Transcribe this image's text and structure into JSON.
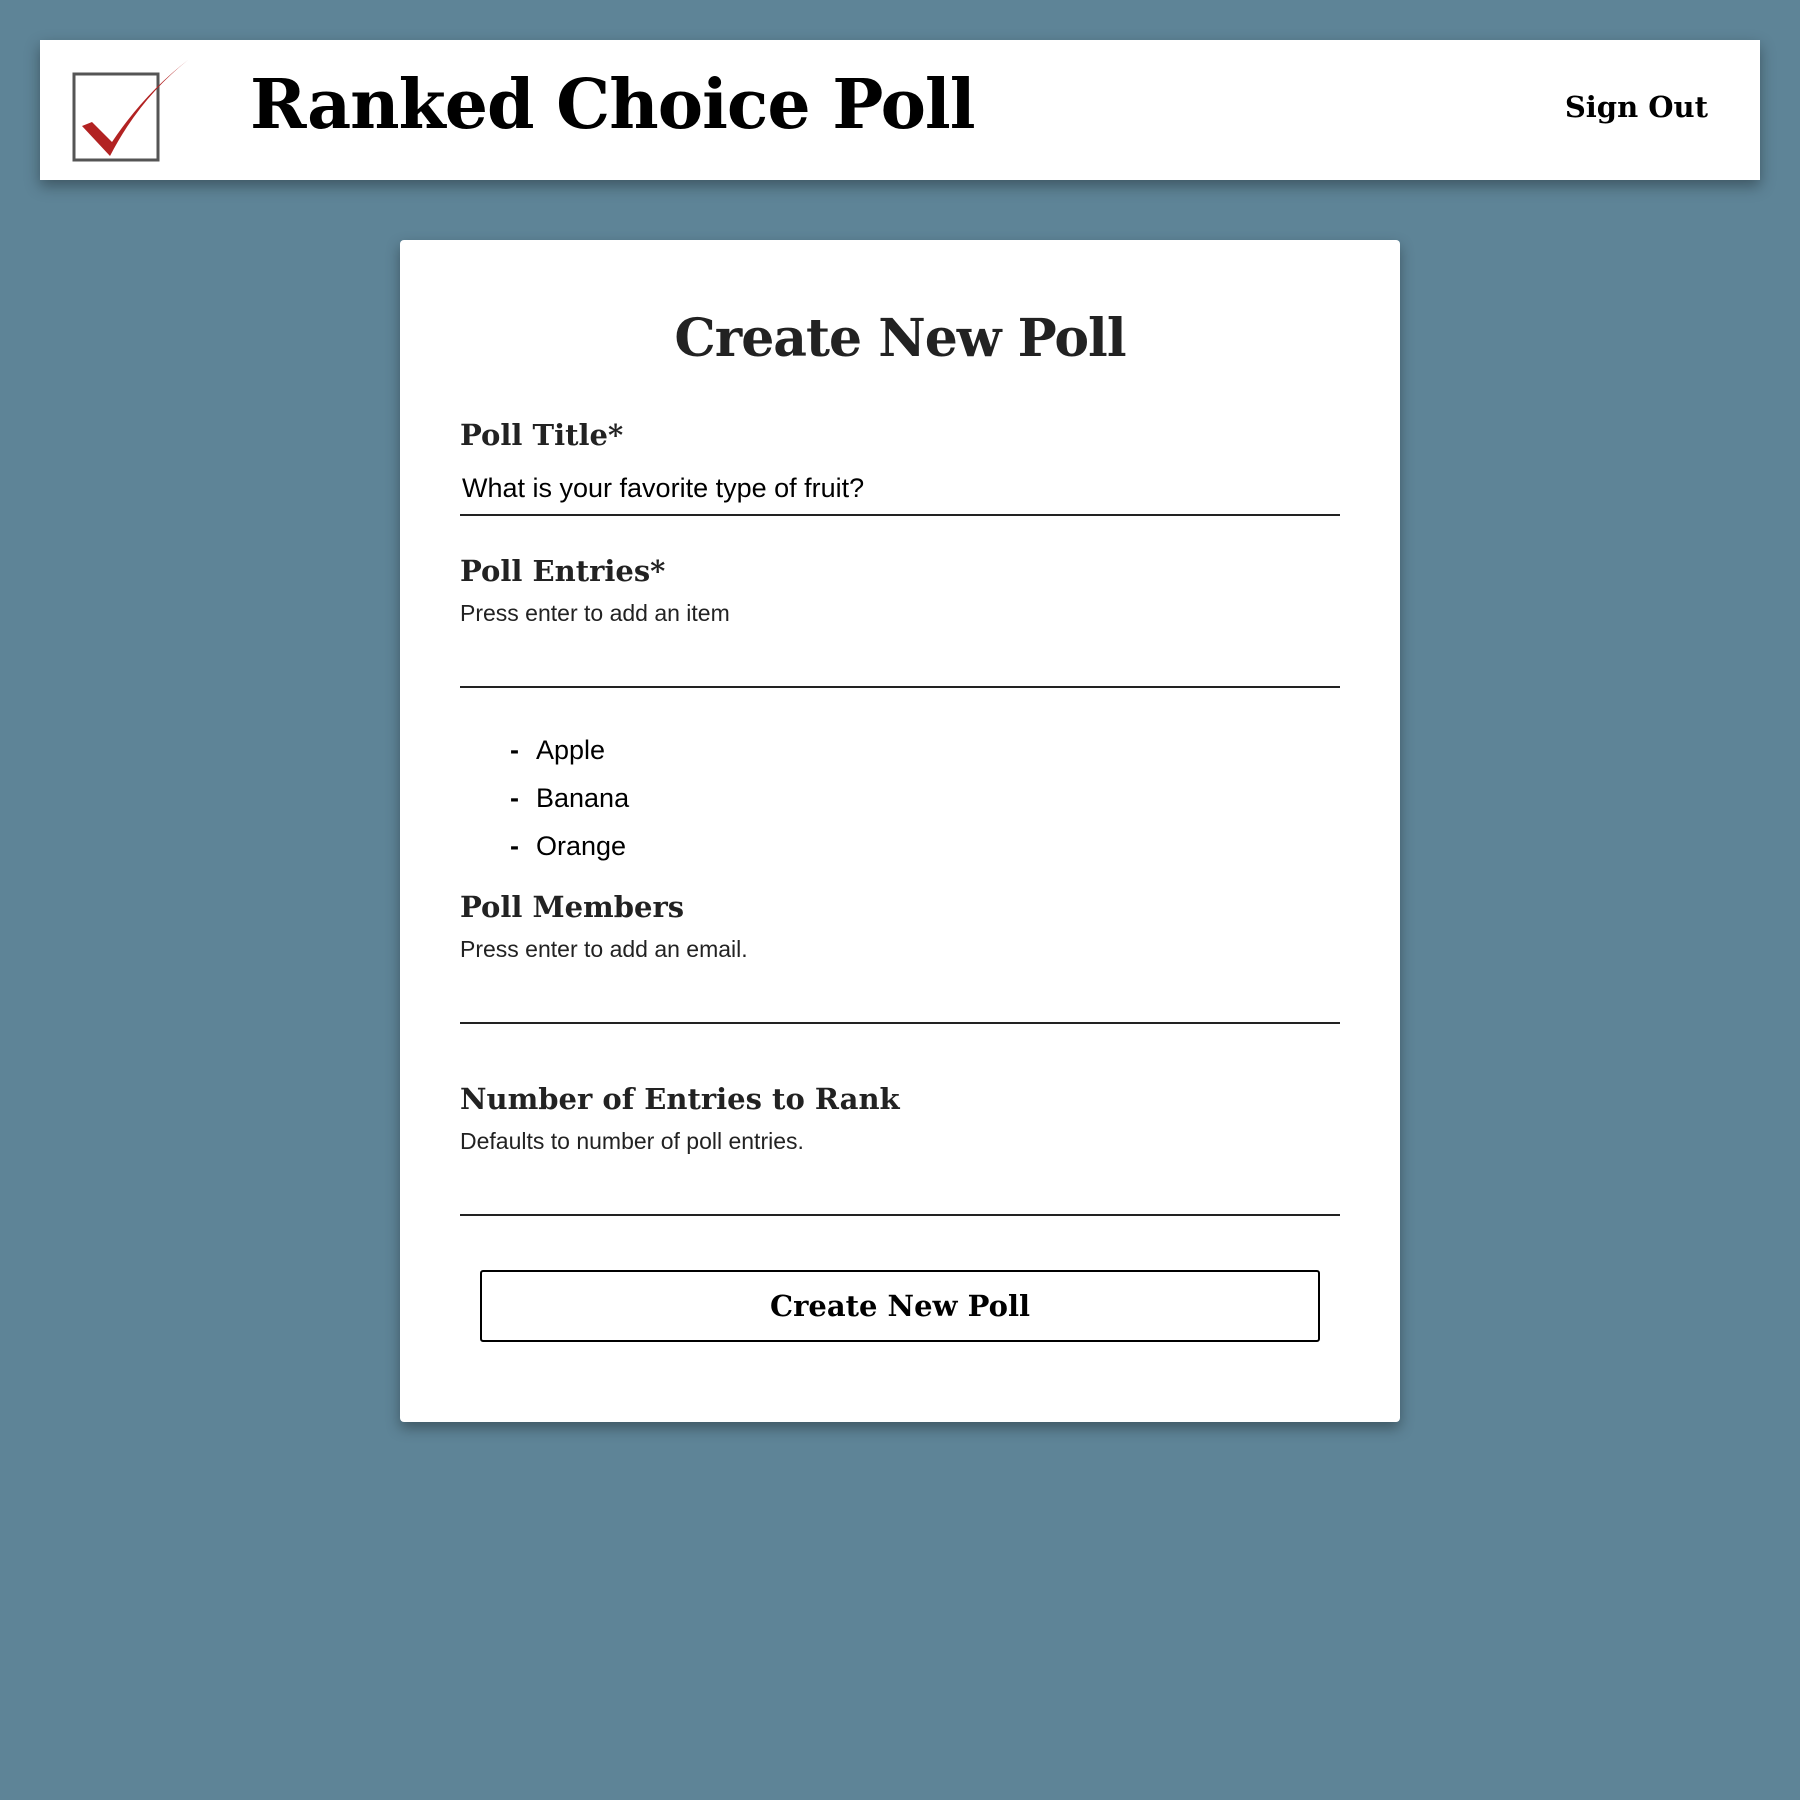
{
  "header": {
    "title": "Ranked Choice Poll",
    "sign_out_label": "Sign Out",
    "logo_icon": "checkbox-check-icon",
    "logo_check_color": "#b22222"
  },
  "form": {
    "heading": "Create New Poll",
    "poll_title": {
      "label": "Poll Title*",
      "value": "What is your favorite type of fruit?"
    },
    "poll_entries": {
      "label": "Poll Entries*",
      "hint": "Press enter to add an item",
      "value": "",
      "items": [
        "Apple",
        "Banana",
        "Orange"
      ],
      "bullet": "-"
    },
    "poll_members": {
      "label": "Poll Members",
      "hint": "Press enter to add an email.",
      "value": ""
    },
    "entries_to_rank": {
      "label": "Number of Entries to Rank",
      "hint": "Defaults to number of poll entries.",
      "value": ""
    },
    "submit_label": "Create New Poll"
  },
  "colors": {
    "background": "#5e8497",
    "card": "#ffffff",
    "text": "#222222"
  }
}
